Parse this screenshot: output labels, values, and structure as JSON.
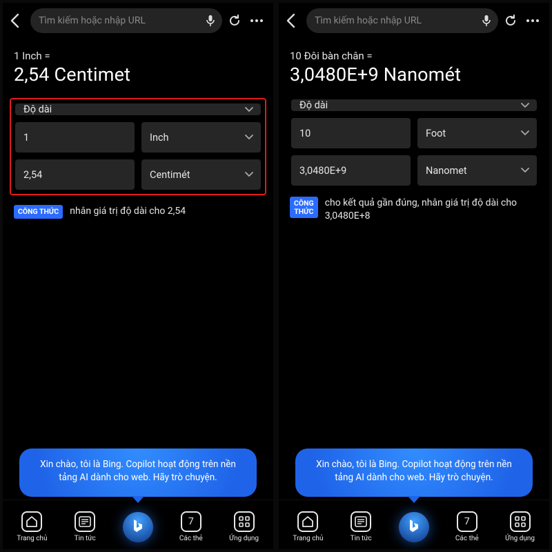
{
  "searchPlaceholder": "Tìm kiếm hoặc nhập URL",
  "left": {
    "heading": "1 Inch =",
    "result": "2,54 Centimet",
    "category": "Độ dài",
    "fromValue": "1",
    "fromUnit": "Inch",
    "toValue": "2,54",
    "toUnit": "Centimét",
    "formulaBadge": "CÔNG THỨC",
    "formulaText": "nhân giá trị độ dài cho 2,54",
    "highlighted": true
  },
  "right": {
    "heading": "10 Đôi bàn chân =",
    "result": "3,0480E+9 Nanomét",
    "category": "Độ dài",
    "fromValue": "10",
    "fromUnit": "Foot",
    "toValue": "3,0480E+9",
    "toUnit": "Nanomet",
    "formulaBadge": "CÔNG\nTHỨC",
    "formulaText": "cho kết quả gần đúng, nhân giá trị độ dài cho 3,0480E+8",
    "highlighted": false
  },
  "chatBubble": "Xin chào, tôi là Bing. Copilot hoạt động trên nền tảng AI dành cho web.\nHãy trò chuyện.",
  "nav": {
    "home": "Trang chủ",
    "news": "Tin tức",
    "tabs": "Các thẻ",
    "tabCount": "7",
    "apps": "Ứng dụng"
  }
}
